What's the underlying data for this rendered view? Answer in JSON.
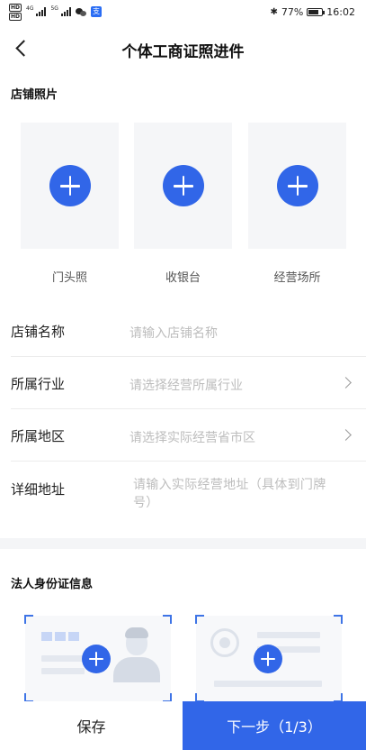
{
  "status_bar": {
    "left_badge_top": "HD",
    "left_badge_bottom": "HD",
    "net1": "4G",
    "net2": "5G",
    "app_icon_glyph": "支",
    "battery_text": "77%",
    "time": "16:02",
    "icons": [
      "hd-icon",
      "signal-icon",
      "signal-icon",
      "wechat-icon",
      "app-icon",
      "bluetooth-icon",
      "battery-icon"
    ]
  },
  "nav": {
    "title": "个体工商证照进件"
  },
  "store_photos": {
    "title": "店铺照片",
    "items": [
      {
        "label": "门头照"
      },
      {
        "label": "收银台"
      },
      {
        "label": "经营场所"
      }
    ]
  },
  "form": {
    "rows": [
      {
        "label": "店铺名称",
        "placeholder": "请输入店铺名称"
      },
      {
        "label": "所属行业",
        "placeholder": "请选择经营所属行业"
      },
      {
        "label": "所属地区",
        "placeholder": "请选择实际经营省市区"
      },
      {
        "label": "详细地址",
        "placeholder": "请输入实际经营地址（具体到门牌号）"
      }
    ]
  },
  "id_section": {
    "title": "法人身份证信息"
  },
  "bottom": {
    "save_label": "保存",
    "next_label": "下一步（1/3）"
  },
  "colors": {
    "accent": "#3166e8",
    "placeholder": "#bdbdbd",
    "tile_bg": "#f5f6f8"
  }
}
